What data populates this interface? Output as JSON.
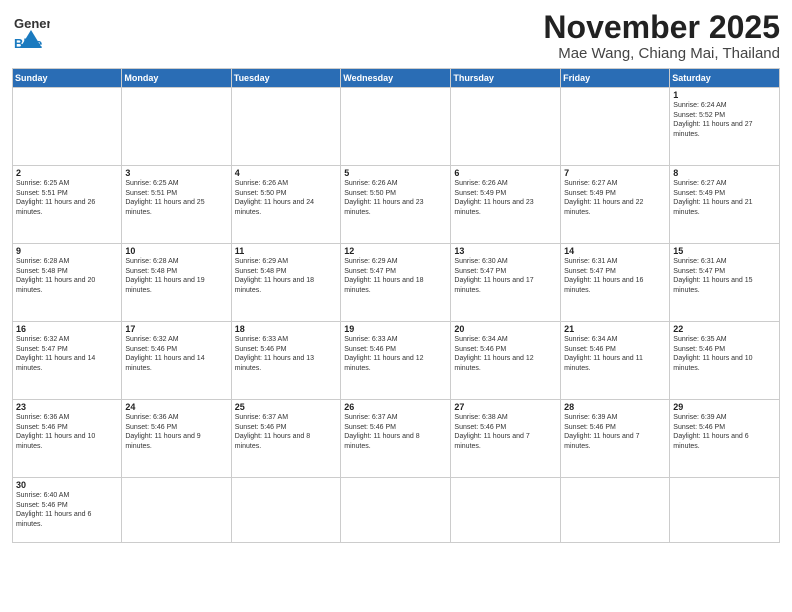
{
  "header": {
    "logo_general": "General",
    "logo_blue": "Blue",
    "month_title": "November 2025",
    "location": "Mae Wang, Chiang Mai, Thailand"
  },
  "days_of_week": [
    "Sunday",
    "Monday",
    "Tuesday",
    "Wednesday",
    "Thursday",
    "Friday",
    "Saturday"
  ],
  "weeks": [
    [
      {
        "date": "",
        "info": ""
      },
      {
        "date": "",
        "info": ""
      },
      {
        "date": "",
        "info": ""
      },
      {
        "date": "",
        "info": ""
      },
      {
        "date": "",
        "info": ""
      },
      {
        "date": "",
        "info": ""
      },
      {
        "date": "1",
        "info": "Sunrise: 6:24 AM\nSunset: 5:52 PM\nDaylight: 11 hours and 27 minutes."
      }
    ],
    [
      {
        "date": "2",
        "info": "Sunrise: 6:25 AM\nSunset: 5:51 PM\nDaylight: 11 hours and 26 minutes."
      },
      {
        "date": "3",
        "info": "Sunrise: 6:25 AM\nSunset: 5:51 PM\nDaylight: 11 hours and 25 minutes."
      },
      {
        "date": "4",
        "info": "Sunrise: 6:26 AM\nSunset: 5:50 PM\nDaylight: 11 hours and 24 minutes."
      },
      {
        "date": "5",
        "info": "Sunrise: 6:26 AM\nSunset: 5:50 PM\nDaylight: 11 hours and 23 minutes."
      },
      {
        "date": "6",
        "info": "Sunrise: 6:26 AM\nSunset: 5:49 PM\nDaylight: 11 hours and 23 minutes."
      },
      {
        "date": "7",
        "info": "Sunrise: 6:27 AM\nSunset: 5:49 PM\nDaylight: 11 hours and 22 minutes."
      },
      {
        "date": "8",
        "info": "Sunrise: 6:27 AM\nSunset: 5:49 PM\nDaylight: 11 hours and 21 minutes."
      }
    ],
    [
      {
        "date": "9",
        "info": "Sunrise: 6:28 AM\nSunset: 5:48 PM\nDaylight: 11 hours and 20 minutes."
      },
      {
        "date": "10",
        "info": "Sunrise: 6:28 AM\nSunset: 5:48 PM\nDaylight: 11 hours and 19 minutes."
      },
      {
        "date": "11",
        "info": "Sunrise: 6:29 AM\nSunset: 5:48 PM\nDaylight: 11 hours and 18 minutes."
      },
      {
        "date": "12",
        "info": "Sunrise: 6:29 AM\nSunset: 5:47 PM\nDaylight: 11 hours and 18 minutes."
      },
      {
        "date": "13",
        "info": "Sunrise: 6:30 AM\nSunset: 5:47 PM\nDaylight: 11 hours and 17 minutes."
      },
      {
        "date": "14",
        "info": "Sunrise: 6:31 AM\nSunset: 5:47 PM\nDaylight: 11 hours and 16 minutes."
      },
      {
        "date": "15",
        "info": "Sunrise: 6:31 AM\nSunset: 5:47 PM\nDaylight: 11 hours and 15 minutes."
      }
    ],
    [
      {
        "date": "16",
        "info": "Sunrise: 6:32 AM\nSunset: 5:47 PM\nDaylight: 11 hours and 14 minutes."
      },
      {
        "date": "17",
        "info": "Sunrise: 6:32 AM\nSunset: 5:46 PM\nDaylight: 11 hours and 14 minutes."
      },
      {
        "date": "18",
        "info": "Sunrise: 6:33 AM\nSunset: 5:46 PM\nDaylight: 11 hours and 13 minutes."
      },
      {
        "date": "19",
        "info": "Sunrise: 6:33 AM\nSunset: 5:46 PM\nDaylight: 11 hours and 12 minutes."
      },
      {
        "date": "20",
        "info": "Sunrise: 6:34 AM\nSunset: 5:46 PM\nDaylight: 11 hours and 12 minutes."
      },
      {
        "date": "21",
        "info": "Sunrise: 6:34 AM\nSunset: 5:46 PM\nDaylight: 11 hours and 11 minutes."
      },
      {
        "date": "22",
        "info": "Sunrise: 6:35 AM\nSunset: 5:46 PM\nDaylight: 11 hours and 10 minutes."
      }
    ],
    [
      {
        "date": "23",
        "info": "Sunrise: 6:36 AM\nSunset: 5:46 PM\nDaylight: 11 hours and 10 minutes."
      },
      {
        "date": "24",
        "info": "Sunrise: 6:36 AM\nSunset: 5:46 PM\nDaylight: 11 hours and 9 minutes."
      },
      {
        "date": "25",
        "info": "Sunrise: 6:37 AM\nSunset: 5:46 PM\nDaylight: 11 hours and 8 minutes."
      },
      {
        "date": "26",
        "info": "Sunrise: 6:37 AM\nSunset: 5:46 PM\nDaylight: 11 hours and 8 minutes."
      },
      {
        "date": "27",
        "info": "Sunrise: 6:38 AM\nSunset: 5:46 PM\nDaylight: 11 hours and 7 minutes."
      },
      {
        "date": "28",
        "info": "Sunrise: 6:39 AM\nSunset: 5:46 PM\nDaylight: 11 hours and 7 minutes."
      },
      {
        "date": "29",
        "info": "Sunrise: 6:39 AM\nSunset: 5:46 PM\nDaylight: 11 hours and 6 minutes."
      }
    ],
    [
      {
        "date": "30",
        "info": "Sunrise: 6:40 AM\nSunset: 5:46 PM\nDaylight: 11 hours and 6 minutes."
      },
      {
        "date": "",
        "info": ""
      },
      {
        "date": "",
        "info": ""
      },
      {
        "date": "",
        "info": ""
      },
      {
        "date": "",
        "info": ""
      },
      {
        "date": "",
        "info": ""
      },
      {
        "date": "",
        "info": ""
      }
    ]
  ]
}
